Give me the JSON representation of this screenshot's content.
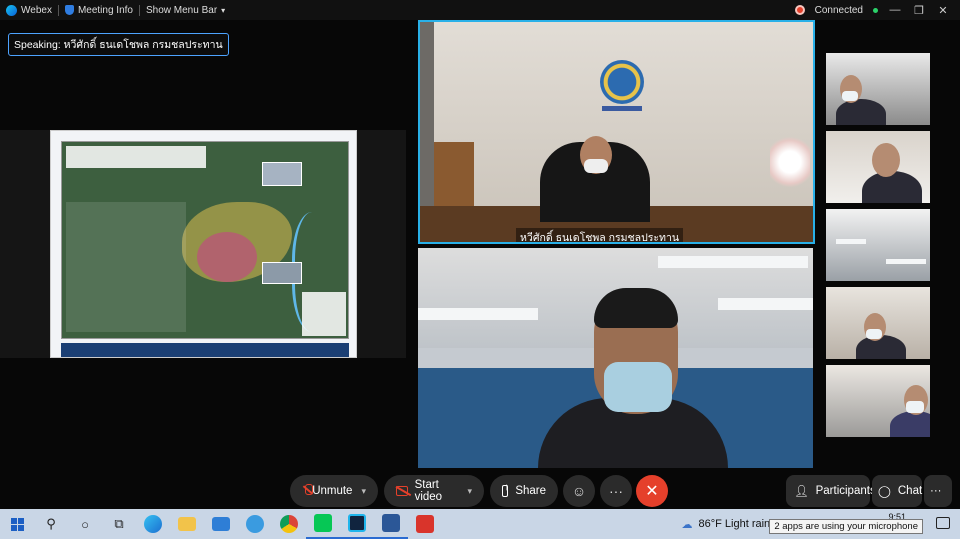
{
  "titlebar": {
    "app": "Webex",
    "meeting_info": "Meeting Info",
    "menu": "Show Menu Bar",
    "status": "Connected"
  },
  "speaking": "Speaking: หวีศักดิ์ ธนเดโชพล กรมชลประทาน",
  "main_video": {
    "name": "หวีศักดิ์ ธนเดโชพล กรมชลประทาน"
  },
  "controls": {
    "unmute": "Unmute",
    "start_video": "Start video",
    "share": "Share",
    "participants": "Participants",
    "chat": "Chat",
    "more": "···"
  },
  "taskbar": {
    "weather": "86°F  Light rain",
    "time": "9:51",
    "tooltip": "2 apps are using your microphone"
  },
  "colors": {
    "accent": "#29b0e8",
    "end_call": "#e5402b",
    "connected": "#2bd26a"
  }
}
